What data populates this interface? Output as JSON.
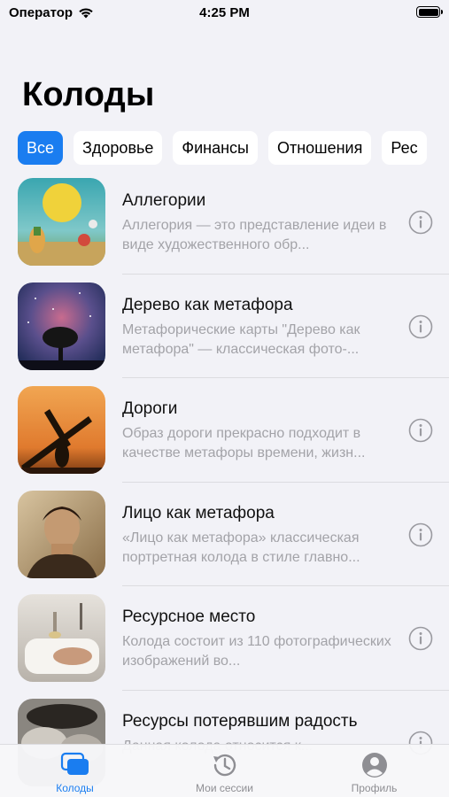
{
  "status": {
    "carrier": "Оператор",
    "time": "4:25 PM"
  },
  "page_title": "Колоды",
  "filters": [
    {
      "label": "Все",
      "active": true
    },
    {
      "label": "Здоровье",
      "active": false
    },
    {
      "label": "Финансы",
      "active": false
    },
    {
      "label": "Отношения",
      "active": false
    },
    {
      "label": "Рес",
      "active": false
    }
  ],
  "decks": [
    {
      "title": "Аллегории",
      "desc": "Аллегория — это представление идеи в виде художественного обр..."
    },
    {
      "title": "Дерево как метафора",
      "desc": "Метафорические карты \"Дерево как метафора\" — классическая фото-..."
    },
    {
      "title": "Дороги",
      "desc": "Образ дороги прекрасно подходит в качестве метафоры времени, жизн..."
    },
    {
      "title": "Лицо как метафора",
      "desc": "«Лицо как метафора» классическая портретная колода в стиле главно..."
    },
    {
      "title": "Ресурсное место",
      "desc": "Колода состоит из 110 фотографических изображений во..."
    },
    {
      "title": "Ресурсы потерявшим радость",
      "desc": "Данная колода относится к..."
    }
  ],
  "tabs": [
    {
      "label": "Колоды",
      "icon": "decks-icon",
      "active": true
    },
    {
      "label": "Мои сессии",
      "icon": "history-icon",
      "active": false
    },
    {
      "label": "Профиль",
      "icon": "profile-icon",
      "active": false
    }
  ],
  "colors": {
    "accent": "#1a7df0",
    "background": "#f2f2f7",
    "secondary_text": "#a3a3a8"
  }
}
